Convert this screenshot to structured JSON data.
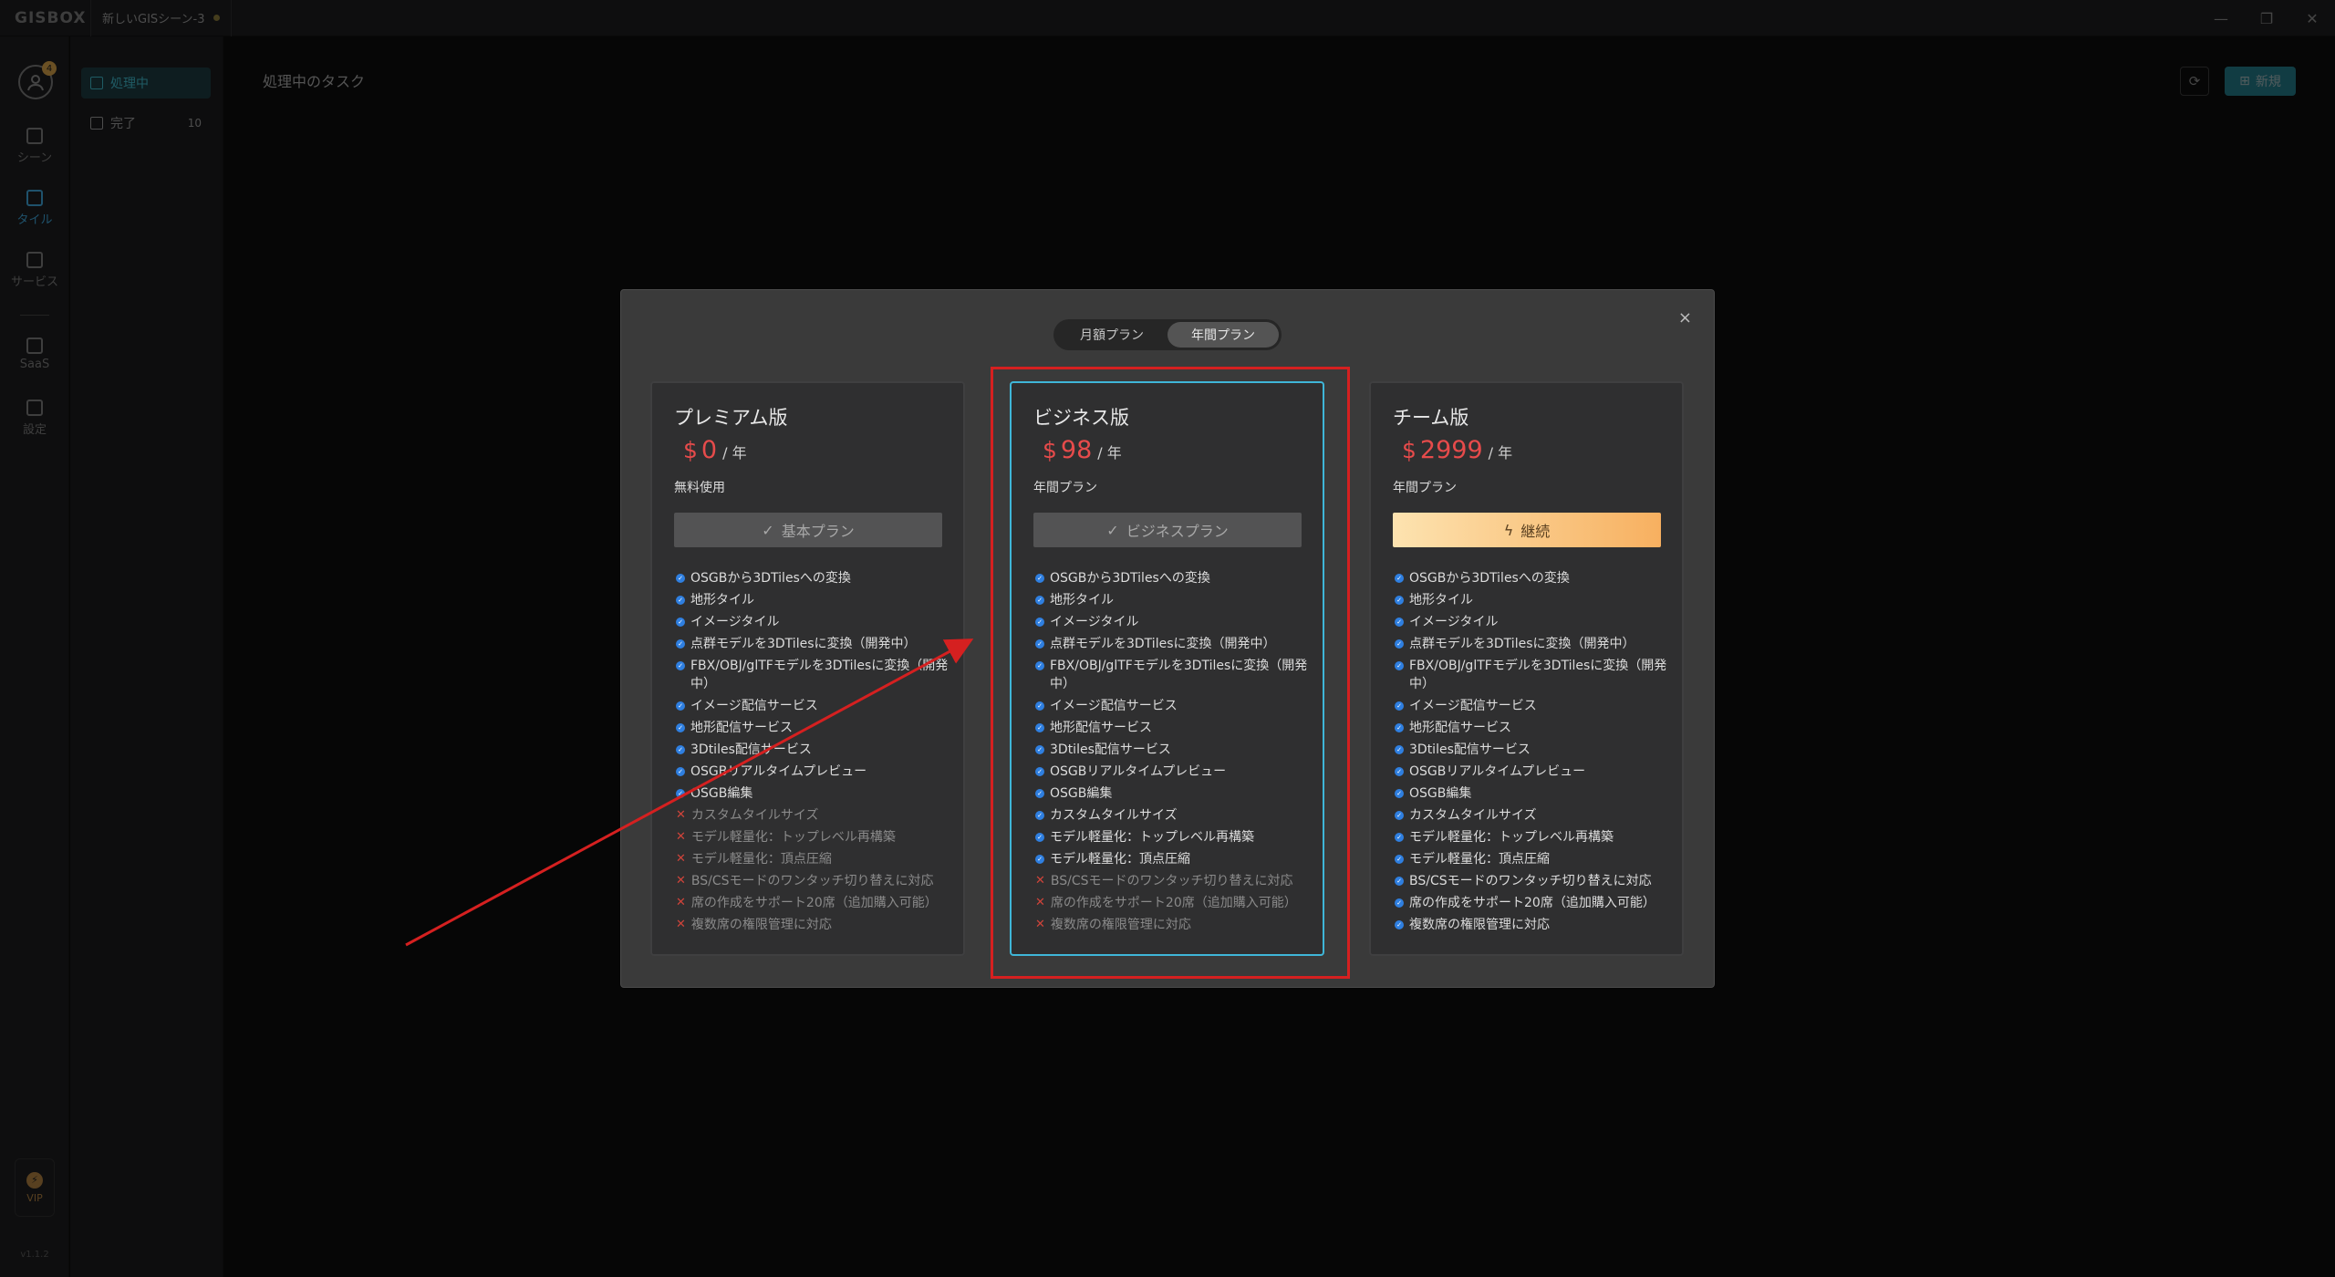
{
  "app": {
    "logo": "GISBOX",
    "document_tab": "新しいGISシーン-3",
    "window_controls": {
      "minimize": "—",
      "restore": "❐",
      "close": "✕"
    }
  },
  "rail": {
    "avatar_badge": "4",
    "items": [
      {
        "label": "シーン",
        "icon": "scene-icon"
      },
      {
        "label": "タイル",
        "icon": "tile-icon"
      },
      {
        "label": "サービス",
        "icon": "service-icon"
      },
      {
        "label": "SaaS",
        "icon": "saas-icon"
      },
      {
        "label": "設定",
        "icon": "settings-icon"
      }
    ],
    "vip_label": "VIP",
    "version": "v1.1.2"
  },
  "side2": {
    "items": [
      {
        "label": "処理中",
        "count": ""
      },
      {
        "label": "完了",
        "count": "10"
      }
    ]
  },
  "main": {
    "title": "処理中のタスク",
    "refresh_icon": "⟳",
    "new_label": "新規"
  },
  "modal": {
    "close": "×",
    "billing_tabs": [
      "月額プラン",
      "年間プラン"
    ],
    "selected_tab": "年間プラン",
    "plans": [
      {
        "name": "プレミアム版",
        "currency": "$",
        "price": "0",
        "unit": "/ 年",
        "subtitle": "無料使用",
        "button": "基本プラン",
        "features": [
          {
            "text": "OSGBから3DTilesへの変換",
            "included": true
          },
          {
            "text": "地形タイル",
            "included": true
          },
          {
            "text": "イメージタイル",
            "included": true
          },
          {
            "text": "点群モデルを3DTilesに変換（開発中）",
            "included": true
          },
          {
            "text": "FBX/OBJ/glTFモデルを3DTilesに変換（開発中）",
            "included": true
          },
          {
            "text": "イメージ配信サービス",
            "included": true
          },
          {
            "text": "地形配信サービス",
            "included": true
          },
          {
            "text": "3Dtiles配信サービス",
            "included": true
          },
          {
            "text": "OSGBリアルタイムプレビュー",
            "included": true
          },
          {
            "text": "OSGB編集",
            "included": true
          },
          {
            "text": "カスタムタイルサイズ",
            "included": false
          },
          {
            "text": "モデル軽量化：トップレベル再構築",
            "included": false
          },
          {
            "text": "モデル軽量化：頂点圧縮",
            "included": false
          },
          {
            "text": "BS/CSモードのワンタッチ切り替えに対応",
            "included": false
          },
          {
            "text": "席の作成をサポート20席（追加購入可能）",
            "included": false
          },
          {
            "text": "複数席の権限管理に対応",
            "included": false
          }
        ]
      },
      {
        "name": "ビジネス版",
        "currency": "$",
        "price": "98",
        "unit": "/ 年",
        "subtitle": "年間プラン",
        "button": "ビジネスプラン",
        "features": [
          {
            "text": "OSGBから3DTilesへの変換",
            "included": true
          },
          {
            "text": "地形タイル",
            "included": true
          },
          {
            "text": "イメージタイル",
            "included": true
          },
          {
            "text": "点群モデルを3DTilesに変換（開発中）",
            "included": true
          },
          {
            "text": "FBX/OBJ/glTFモデルを3DTilesに変換（開発中）",
            "included": true
          },
          {
            "text": "イメージ配信サービス",
            "included": true
          },
          {
            "text": "地形配信サービス",
            "included": true
          },
          {
            "text": "3Dtiles配信サービス",
            "included": true
          },
          {
            "text": "OSGBリアルタイムプレビュー",
            "included": true
          },
          {
            "text": "OSGB編集",
            "included": true
          },
          {
            "text": "カスタムタイルサイズ",
            "included": true
          },
          {
            "text": "モデル軽量化：トップレベル再構築",
            "included": true
          },
          {
            "text": "モデル軽量化：頂点圧縮",
            "included": true
          },
          {
            "text": "BS/CSモードのワンタッチ切り替えに対応",
            "included": false
          },
          {
            "text": "席の作成をサポート20席（追加購入可能）",
            "included": false
          },
          {
            "text": "複数席の権限管理に対応",
            "included": false
          }
        ]
      },
      {
        "name": "チーム版",
        "currency": "$",
        "price": "2999",
        "unit": "/ 年",
        "subtitle": "年間プラン",
        "button": "継続",
        "features": [
          {
            "text": "OSGBから3DTilesへの変換",
            "included": true
          },
          {
            "text": "地形タイル",
            "included": true
          },
          {
            "text": "イメージタイル",
            "included": true
          },
          {
            "text": "点群モデルを3DTilesに変換（開発中）",
            "included": true
          },
          {
            "text": "FBX/OBJ/glTFモデルを3DTilesに変換（開発中）",
            "included": true
          },
          {
            "text": "イメージ配信サービス",
            "included": true
          },
          {
            "text": "地形配信サービス",
            "included": true
          },
          {
            "text": "3Dtiles配信サービス",
            "included": true
          },
          {
            "text": "OSGBリアルタイムプレビュー",
            "included": true
          },
          {
            "text": "OSGB編集",
            "included": true
          },
          {
            "text": "カスタムタイルサイズ",
            "included": true
          },
          {
            "text": "モデル軽量化：トップレベル再構築",
            "included": true
          },
          {
            "text": "モデル軽量化：頂点圧縮",
            "included": true
          },
          {
            "text": "BS/CSモードのワンタッチ切り替えに対応",
            "included": true
          },
          {
            "text": "席の作成をサポート20席（追加購入可能）",
            "included": true
          },
          {
            "text": "複数席の権限管理に対応",
            "included": true
          }
        ]
      }
    ]
  },
  "colors": {
    "accent": "#3fb6c8",
    "price": "#e64b4b",
    "annotation": "#d52020",
    "check": "#2f7fe0",
    "cross": "#d0443a"
  }
}
